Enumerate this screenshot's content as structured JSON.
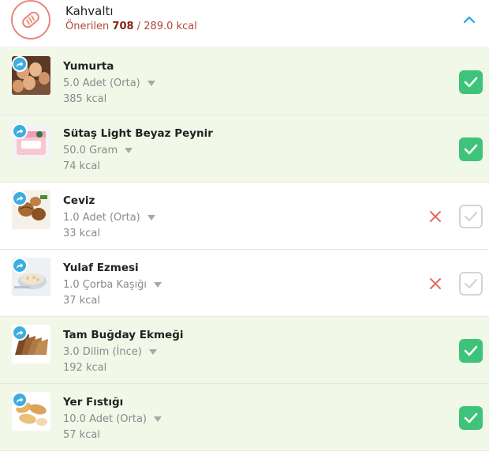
{
  "meal": {
    "title": "Kahvaltı",
    "recommended_label": "Önerilen",
    "recommended_value": "708",
    "separator": "/",
    "consumed": "289.0 kcal",
    "icon": "bread-icon",
    "accent_color": "#e8867a"
  },
  "items": [
    {
      "name": "Yumurta",
      "portion": "5.0 Adet (Orta)",
      "kcal": "385 kcal",
      "checked": true
    },
    {
      "name": "Sütaş Light Beyaz Peynir",
      "portion": "50.0 Gram",
      "kcal": "74 kcal",
      "checked": true
    },
    {
      "name": "Ceviz",
      "portion": "1.0 Adet (Orta)",
      "kcal": "33 kcal",
      "checked": false
    },
    {
      "name": "Yulaf Ezmesi",
      "portion": "1.0 Çorba Kaşığı",
      "kcal": "37 kcal",
      "checked": false
    },
    {
      "name": "Tam Buğday Ekmeği",
      "portion": "3.0 Dilim (İnce)",
      "kcal": "192 kcal",
      "checked": true
    },
    {
      "name": "Yer Fıstığı",
      "portion": "10.0 Adet (Orta)",
      "kcal": "57 kcal",
      "checked": true
    }
  ],
  "colors": {
    "checked_bg": "#3ec37a",
    "done_row_bg": "#f1f8e8",
    "share_badge": "#3aaee0",
    "remove_x": "#e86a5e",
    "collapse_chevron": "#3aaee0"
  }
}
